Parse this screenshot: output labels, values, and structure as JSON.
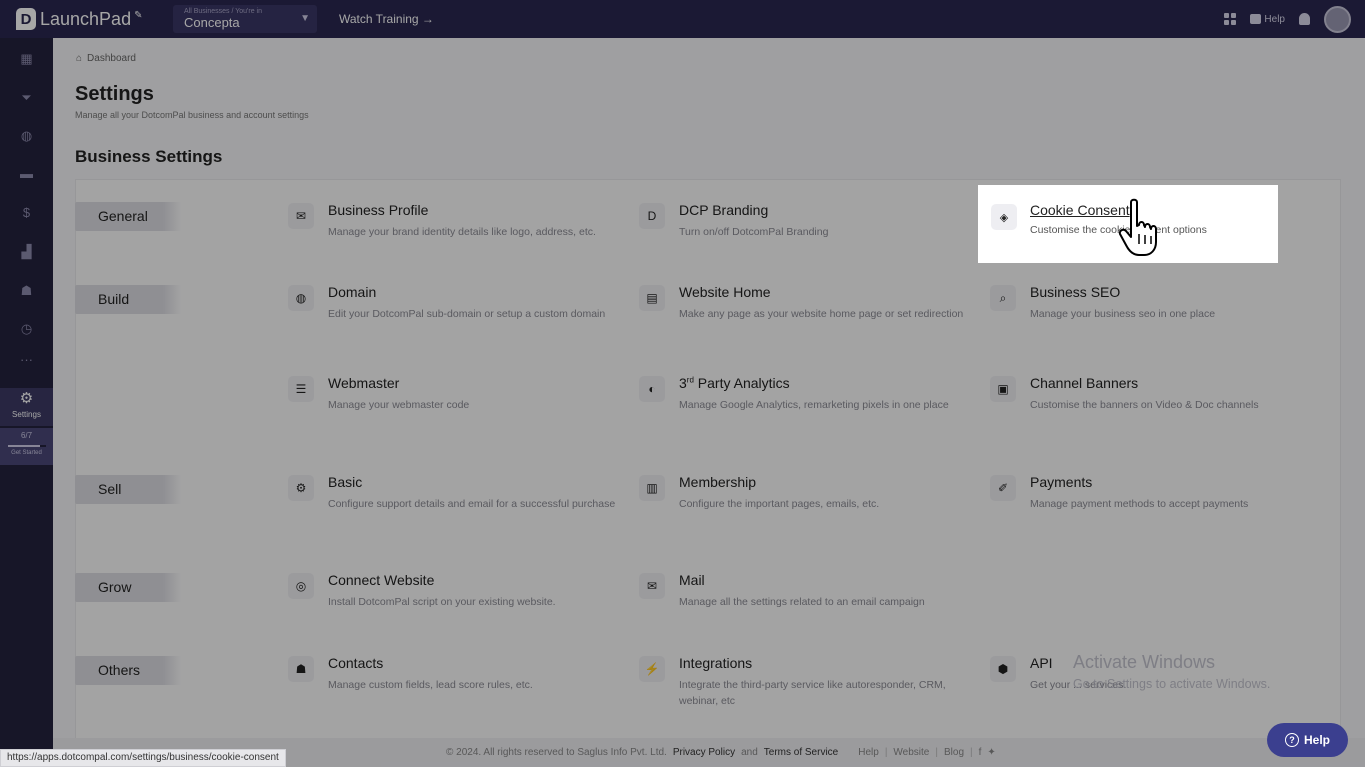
{
  "topbar": {
    "logo_text": "LaunchPad",
    "business_hint": "All Businesses / You're in",
    "business_name": "Concepta",
    "watch_training": "Watch Training →",
    "help_label": "Help"
  },
  "sidebar": {
    "settings_label": "Settings",
    "progress_count": "6/7",
    "progress_fraction": 0.86,
    "get_started_label": "Get Started"
  },
  "breadcrumb": {
    "label": "Dashboard"
  },
  "page": {
    "title": "Settings",
    "subtitle": "Manage all your DotcomPal business and account settings",
    "section_title": "Business Settings"
  },
  "categories": {
    "general": "General",
    "build": "Build",
    "sell": "Sell",
    "grow": "Grow",
    "others": "Others"
  },
  "items": {
    "business_profile": {
      "name": "Business Profile",
      "desc": "Manage your brand identity details like logo, address, etc.",
      "icon": "envelope-card-icon"
    },
    "dcp_branding": {
      "name": "DCP Branding",
      "desc": "Turn on/off DotcomPal Branding",
      "icon": "brand-d-icon"
    },
    "cookie_consent": {
      "name": "Cookie Consent",
      "desc": "Customise the cookie consent options",
      "icon": "cookie-icon"
    },
    "domain": {
      "name": "Domain",
      "desc": "Edit your DotcomPal sub-domain or setup a custom domain",
      "icon": "globe-icon"
    },
    "website_home": {
      "name": "Website Home",
      "desc": "Make any page as your website home page or set redirection",
      "icon": "webpage-icon"
    },
    "business_seo": {
      "name": "Business SEO",
      "desc": "Manage your business seo in one place",
      "icon": "magnifier-icon"
    },
    "webmaster": {
      "name": "Webmaster",
      "desc": "Manage your webmaster code",
      "icon": "webmaster-icon"
    },
    "analytics": {
      "name_prefix": "3",
      "name_sup": "rd",
      "name_rest": " Party Analytics",
      "desc": "Manage Google Analytics, remarketing pixels in one place",
      "icon": "analytics-icon"
    },
    "channel_banners": {
      "name": "Channel Banners",
      "desc": "Customise the banners on Video & Doc channels",
      "icon": "banner-icon"
    },
    "basic": {
      "name": "Basic",
      "desc": "Configure support details and email for a successful purchase",
      "icon": "gear-icon"
    },
    "membership": {
      "name": "Membership",
      "desc": "Configure the important pages, emails, etc.",
      "icon": "membership-icon"
    },
    "payments": {
      "name": "Payments",
      "desc": "Manage payment methods to accept payments",
      "icon": "payment-icon"
    },
    "connect_website": {
      "name": "Connect Website",
      "desc": "Install DotcomPal script on your existing website.",
      "icon": "connect-icon"
    },
    "mail": {
      "name": "Mail",
      "desc": "Manage all the settings related to an email campaign",
      "icon": "mail-icon"
    },
    "contacts": {
      "name": "Contacts",
      "desc": "Manage custom fields, lead score rules, etc.",
      "icon": "people-icon"
    },
    "integrations": {
      "name": "Integrations",
      "desc": "Integrate the third-party service like autoresponder, CRM, webinar, etc",
      "icon": "plug-icon"
    },
    "api": {
      "name": "API",
      "desc": "Get your ... services.",
      "icon": "cube-icon"
    }
  },
  "footer": {
    "copyright": "© 2024. All rights reserved to Saglus Info Pvt. Ltd.",
    "privacy": "Privacy Policy",
    "and": "and",
    "terms": "Terms of Service",
    "help": "Help",
    "website": "Website",
    "blog": "Blog"
  },
  "status_url": "https://apps.dotcompal.com/settings/business/cookie-consent",
  "activate_windows": {
    "line1": "Activate Windows",
    "line2": "Go to Settings to activate Windows."
  },
  "help_button": "Help"
}
